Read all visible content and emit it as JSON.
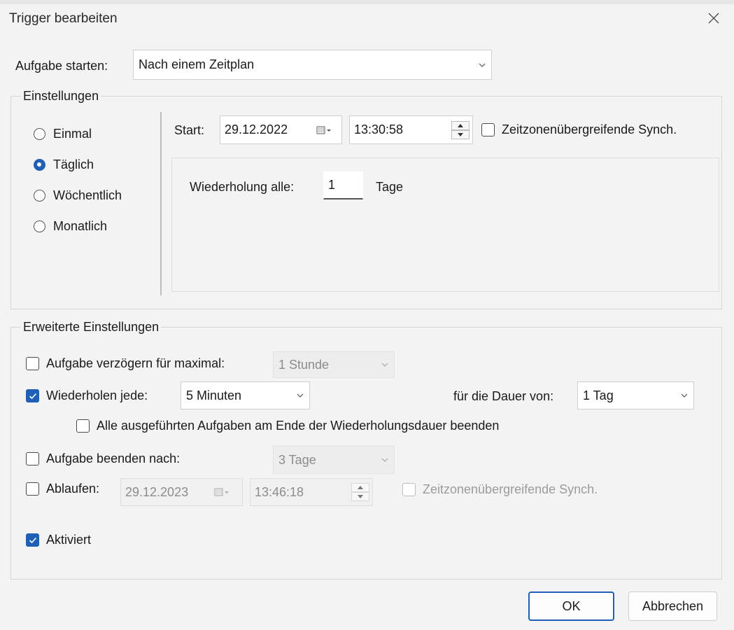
{
  "window": {
    "title": "Trigger bearbeiten"
  },
  "start_task": {
    "label": "Aufgabe starten:",
    "value": "Nach einem Zeitplan"
  },
  "settings": {
    "title": "Einstellungen",
    "radios": [
      {
        "label": "Einmal",
        "selected": false
      },
      {
        "label": "Täglich",
        "selected": true
      },
      {
        "label": "Wöchentlich",
        "selected": false
      },
      {
        "label": "Monatlich",
        "selected": false
      }
    ],
    "start_label": "Start:",
    "start_date": "29.12.2022",
    "start_time": "13:30:58",
    "sync_label": "Zeitzonenübergreifende Synch.",
    "sync_checked": false,
    "recur_label": "Wiederholung alle:",
    "recur_value": "1",
    "recur_unit": "Tage"
  },
  "advanced": {
    "title": "Erweiterte Einstellungen",
    "delay_label": "Aufgabe verzögern für maximal:",
    "delay_checked": false,
    "delay_value": "1 Stunde",
    "repeat_label": "Wiederholen jede:",
    "repeat_checked": true,
    "repeat_value": "5 Minuten",
    "duration_label": "für die Dauer von:",
    "duration_value": "1 Tag",
    "stop_all_label": "Alle ausgeführten Aufgaben am Ende der Wiederholungsdauer beenden",
    "stop_all_checked": false,
    "stop_after_label": "Aufgabe beenden nach:",
    "stop_after_checked": false,
    "stop_after_value": "3 Tage",
    "expire_label": "Ablaufen:",
    "expire_checked": false,
    "expire_date": "29.12.2023",
    "expire_time": "13:46:18",
    "expire_sync_label": "Zeitzonenübergreifende Synch.",
    "enabled_label": "Aktiviert",
    "enabled_checked": true
  },
  "buttons": {
    "ok": "OK",
    "cancel": "Abbrechen"
  },
  "colors": {
    "accent": "#1f5fb4",
    "background": "#f3f3f3"
  }
}
